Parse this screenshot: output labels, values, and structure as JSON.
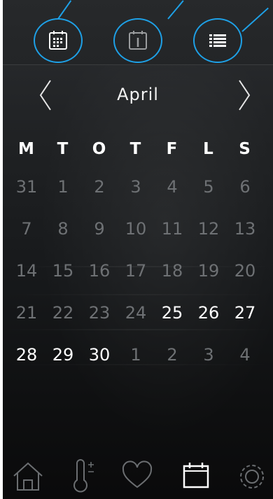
{
  "calendar": {
    "month": "April",
    "weekdays": [
      "M",
      "T",
      "O",
      "T",
      "F",
      "L",
      "S"
    ],
    "weeks": [
      [
        {
          "d": "31",
          "cur": false
        },
        {
          "d": "1",
          "cur": false
        },
        {
          "d": "2",
          "cur": false
        },
        {
          "d": "3",
          "cur": false
        },
        {
          "d": "4",
          "cur": false
        },
        {
          "d": "5",
          "cur": false
        },
        {
          "d": "6",
          "cur": false
        }
      ],
      [
        {
          "d": "7",
          "cur": false
        },
        {
          "d": "8",
          "cur": false
        },
        {
          "d": "9",
          "cur": false
        },
        {
          "d": "10",
          "cur": false
        },
        {
          "d": "11",
          "cur": false
        },
        {
          "d": "12",
          "cur": false
        },
        {
          "d": "13",
          "cur": false
        }
      ],
      [
        {
          "d": "14",
          "cur": false
        },
        {
          "d": "15",
          "cur": false
        },
        {
          "d": "16",
          "cur": false
        },
        {
          "d": "17",
          "cur": false
        },
        {
          "d": "18",
          "cur": false
        },
        {
          "d": "19",
          "cur": false
        },
        {
          "d": "20",
          "cur": false
        }
      ],
      [
        {
          "d": "21",
          "cur": false
        },
        {
          "d": "22",
          "cur": false
        },
        {
          "d": "23",
          "cur": false
        },
        {
          "d": "24",
          "cur": false
        },
        {
          "d": "25",
          "cur": true
        },
        {
          "d": "26",
          "cur": true
        },
        {
          "d": "27",
          "cur": true
        }
      ],
      [
        {
          "d": "28",
          "cur": true
        },
        {
          "d": "29",
          "cur": true
        },
        {
          "d": "30",
          "cur": true
        },
        {
          "d": "1",
          "cur": false
        },
        {
          "d": "2",
          "cur": false
        },
        {
          "d": "3",
          "cur": false
        },
        {
          "d": "4",
          "cur": false
        }
      ]
    ]
  },
  "view_buttons": [
    {
      "icon": "month-grid-calendar-icon"
    },
    {
      "icon": "day-calendar-icon"
    },
    {
      "icon": "list-icon"
    }
  ],
  "bottom_nav": [
    {
      "icon": "home-icon"
    },
    {
      "icon": "thermometer-icon"
    },
    {
      "icon": "heart-icon"
    },
    {
      "icon": "calendar-icon"
    },
    {
      "icon": "settings-gear-icon"
    }
  ],
  "colors": {
    "accent": "#1ea0e6",
    "text": "#ffffff",
    "dim_text": "#6e7174",
    "background": "#17191b"
  }
}
